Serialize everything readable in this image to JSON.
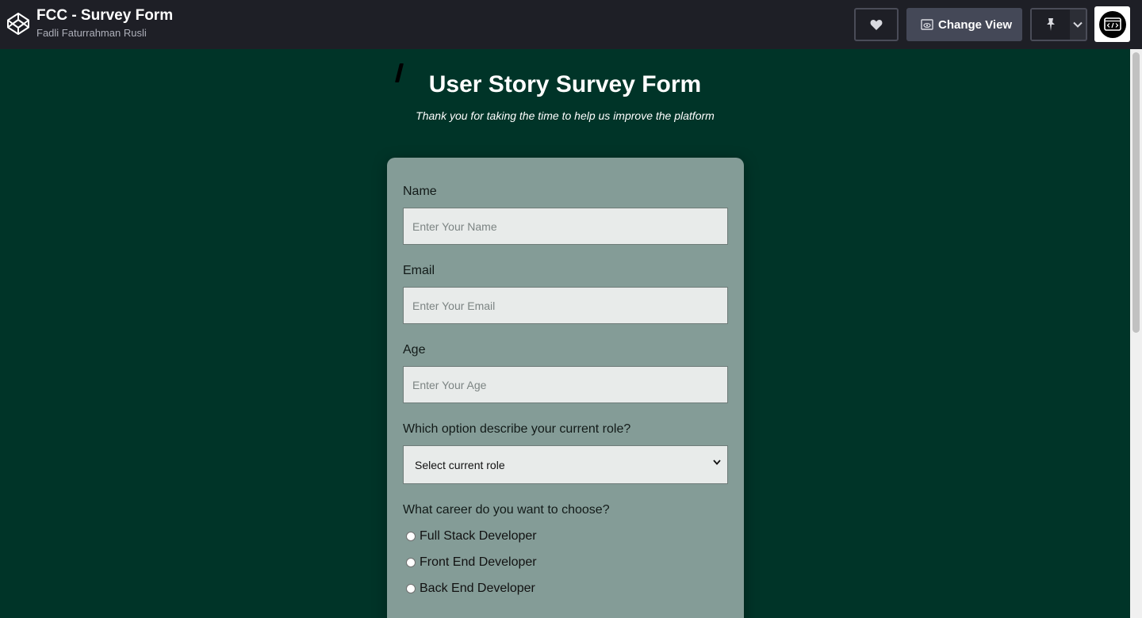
{
  "header": {
    "title": "FCC - Survey Form",
    "author": "Fadli Faturrahman Rusli",
    "change_view_label": "Change View",
    "icons": {
      "logo": "codepen-logo-icon",
      "heart": "heart-icon",
      "change_view": "eye-icon",
      "pin": "pin-icon",
      "dropdown": "chevron-down-icon",
      "avatar": "code-avatar-icon"
    }
  },
  "page": {
    "heading": "User Story Survey Form",
    "subheading": "Thank you for taking the time to help us improve the platform"
  },
  "form": {
    "name_label": "Name",
    "name_placeholder": "Enter Your Name",
    "email_label": "Email",
    "email_placeholder": "Enter Your Email",
    "age_label": "Age",
    "age_placeholder": "Enter Your Age",
    "role_label": "Which option describe your current role?",
    "role_selected": "Select current role",
    "career_label": "What career do you want to choose?",
    "career_options": [
      "Full Stack Developer",
      "Front End Developer",
      "Back End Developer"
    ]
  },
  "colors": {
    "background": "#003428",
    "topbar": "#1e1f26",
    "card": "#849c97"
  }
}
